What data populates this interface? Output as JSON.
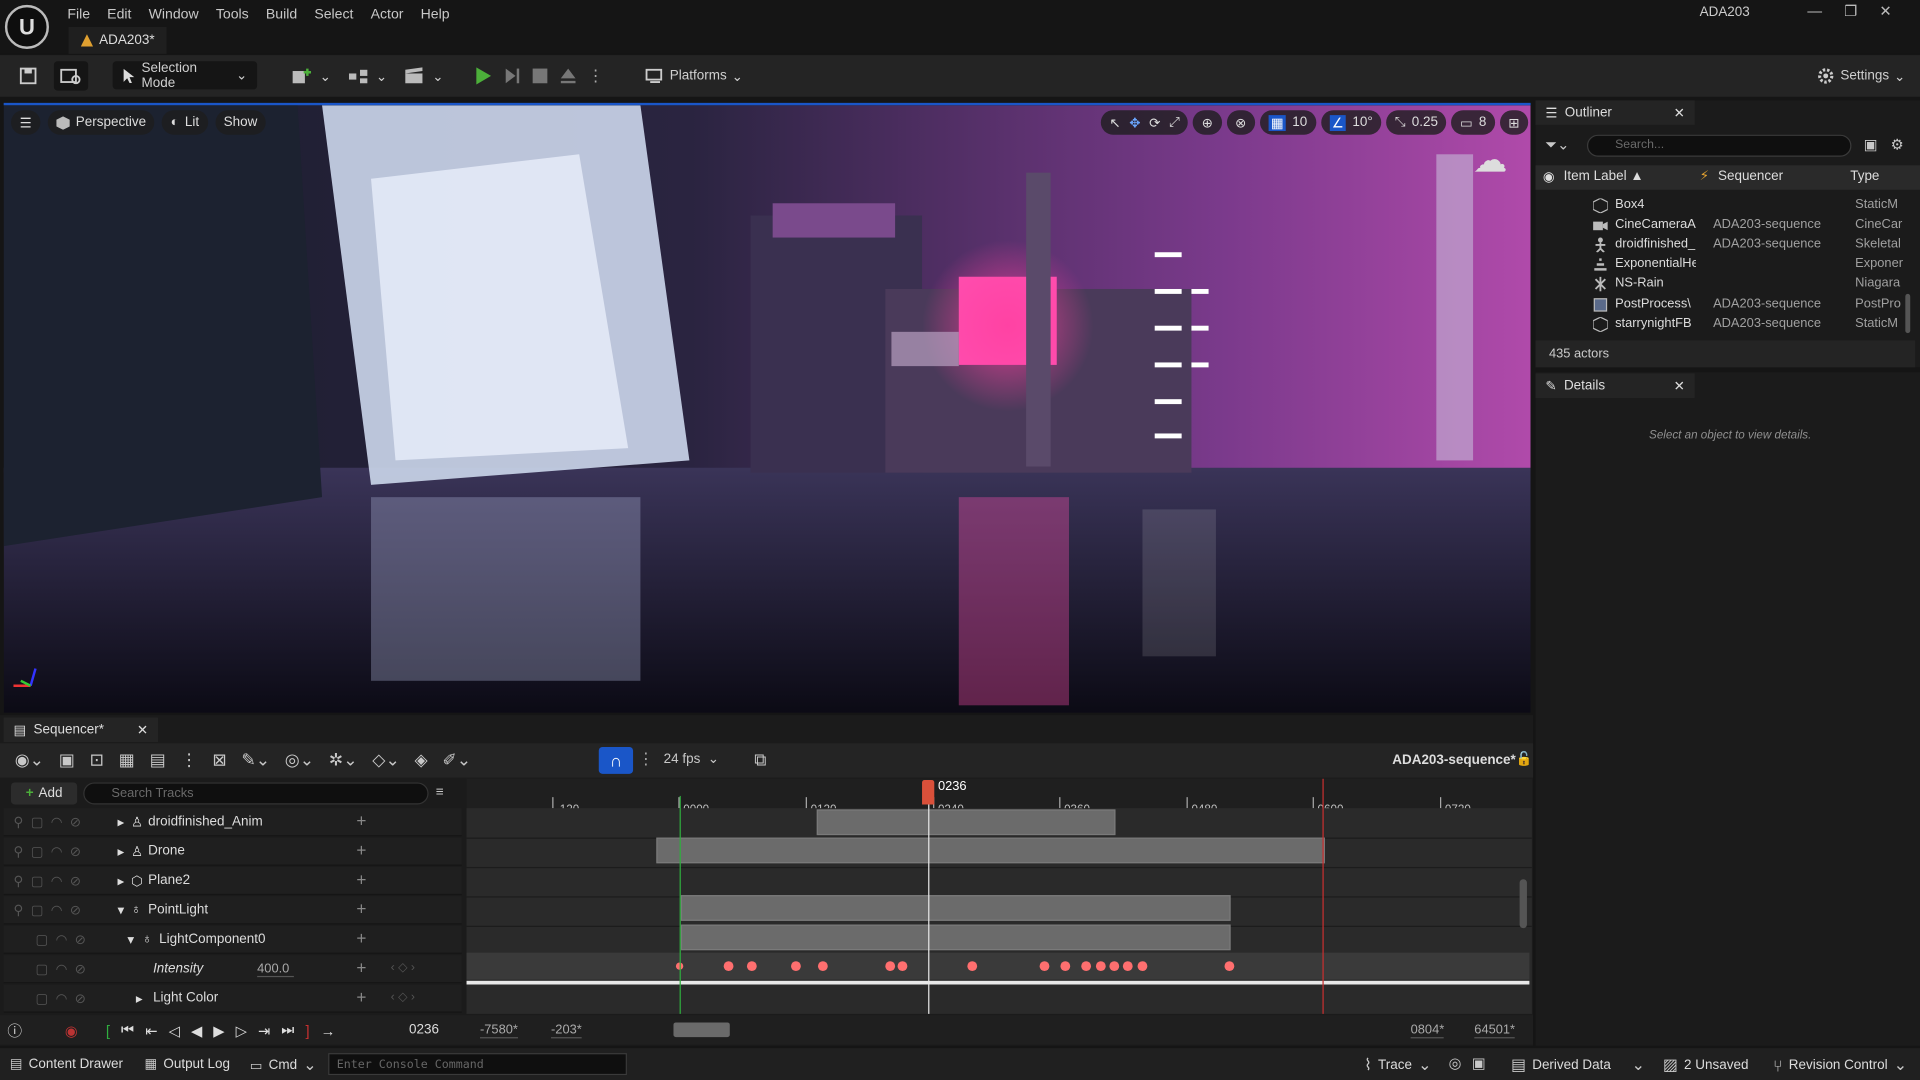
{
  "menu": [
    "File",
    "Edit",
    "Window",
    "Tools",
    "Build",
    "Select",
    "Actor",
    "Help"
  ],
  "level_tab": "ADA203*",
  "project_name": "ADA203",
  "toolbar": {
    "selection_mode": "Selection Mode",
    "platforms": "Platforms",
    "settings": "Settings"
  },
  "viewport": {
    "perspective": "Perspective",
    "lit": "Lit",
    "show": "Show",
    "grid_snap": "10",
    "angle_snap": "10°",
    "scale_snap": "0.25",
    "camera_speed": "8"
  },
  "outliner": {
    "tab": "Outliner",
    "search_placeholder": "Search...",
    "col_label": "Item Label ▲",
    "col_sequencer": "Sequencer",
    "col_type": "Type",
    "rows": [
      {
        "label": "Box4",
        "seq": "",
        "type": "StaticM"
      },
      {
        "label": "CineCameraA",
        "seq": "ADA203-sequence",
        "type": "CineCar"
      },
      {
        "label": "droidfinished_",
        "seq": "ADA203-sequence",
        "type": "Skeletal"
      },
      {
        "label": "ExponentialHe",
        "seq": "",
        "type": "Exponer"
      },
      {
        "label": "NS-Rain",
        "seq": "",
        "type": "Niagara"
      },
      {
        "label": "PostProcess\\",
        "seq": "ADA203-sequence",
        "type": "PostPro"
      },
      {
        "label": "starrynightFB",
        "seq": "ADA203-sequence",
        "type": "StaticM"
      }
    ],
    "count": "435 actors"
  },
  "details": {
    "tab": "Details",
    "empty_message": "Select an object to view details."
  },
  "sequencer": {
    "tab": "Sequencer*",
    "fps": "24 fps",
    "sequence_name": "ADA203-sequence*",
    "add_label": "Add",
    "search_placeholder": "Search Tracks",
    "playhead": "0236",
    "ticks": [
      "-120",
      "0000",
      "0120",
      "0240",
      "0360",
      "0480",
      "0600",
      "0720"
    ],
    "tracks": [
      {
        "name": "droidfinished_Anim"
      },
      {
        "name": "Drone"
      },
      {
        "name": "Plane2"
      },
      {
        "name": "PointLight"
      },
      {
        "name": "LightComponent0"
      },
      {
        "name": "Intensity",
        "value": "400.0"
      },
      {
        "name": "Light Color"
      }
    ],
    "transport": {
      "frame": "0236",
      "range_start": "-7580*",
      "range_view": "-203*",
      "range_end_view": "0804*",
      "range_end": "64501*"
    }
  },
  "statusbar": {
    "content_drawer": "Content Drawer",
    "output_log": "Output Log",
    "cmd": "Cmd",
    "console_placeholder": "Enter Console Command",
    "trace": "Trace",
    "derived_data": "Derived Data",
    "unsaved": "2 Unsaved",
    "revision": "Revision Control"
  },
  "colors": {
    "accent": "#1a56c8",
    "keyframe": "#ff6f6f",
    "play": "#4caf3a"
  }
}
